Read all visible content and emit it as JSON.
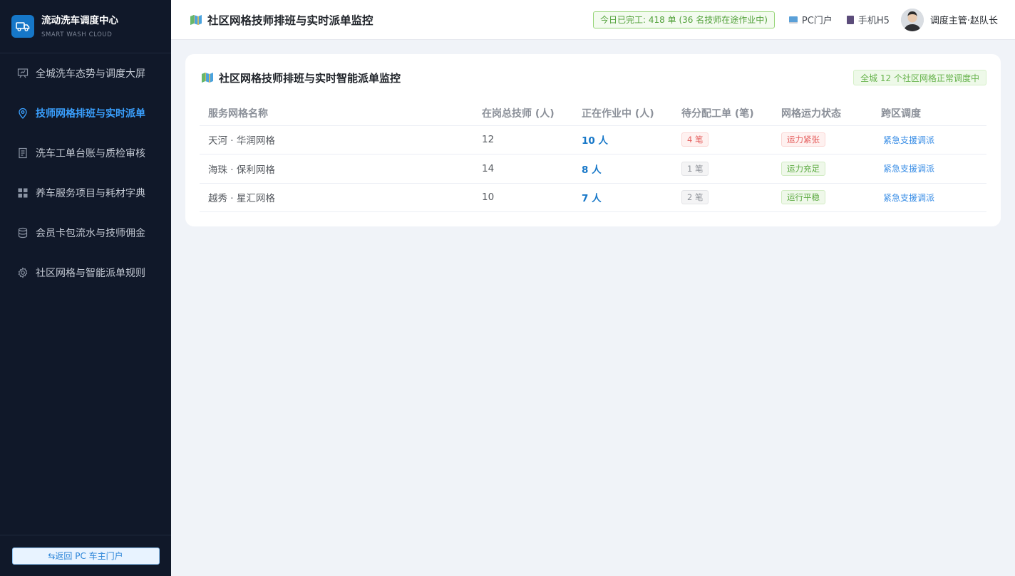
{
  "brand": {
    "title": "流动洗车调度中心",
    "subtitle": "SMART WASH CLOUD"
  },
  "sidebar": {
    "items": [
      {
        "label": "全城洗车态势与调度大屏",
        "icon": "presentation-board-icon",
        "active": false
      },
      {
        "label": "技师网格排班与实时派单",
        "icon": "location-pin-icon",
        "active": true
      },
      {
        "label": "洗车工单台账与质检审核",
        "icon": "document-icon",
        "active": false
      },
      {
        "label": "养车服务项目与耗材字典",
        "icon": "grid-apps-icon",
        "active": false
      },
      {
        "label": "会员卡包流水与技师佣金",
        "icon": "database-coins-icon",
        "active": false
      },
      {
        "label": "社区网格与智能派单规则",
        "icon": "gear-icon",
        "active": false
      }
    ],
    "back_button": "⇆返回 PC 车主门户"
  },
  "header": {
    "title": "社区网格技师排班与实时派单监控",
    "done_tag": "今日已完工: 418 单 (36 名技师在途作业中)",
    "pc_link": "PC门户",
    "h5_link": "手机H5",
    "user_name": "调度主管·赵队长"
  },
  "card": {
    "title": "社区网格技师排班与实时智能派单监控",
    "status_tag": "全城 12 个社区网格正常调度中",
    "columns": [
      "服务网格名称",
      "在岗总技师 (人)",
      "正在作业中 (人)",
      "待分配工单 (笔)",
      "网格运力状态",
      "跨区调度"
    ],
    "rows": [
      {
        "name": "天河 · 华润网格",
        "total": "12",
        "working": "10 人",
        "pending": "4 笔",
        "pending_style": "red",
        "status": "运力紧张",
        "status_style": "red",
        "action": "紧急支援调派"
      },
      {
        "name": "海珠 · 保利网格",
        "total": "14",
        "working": "8 人",
        "pending": "1 笔",
        "pending_style": "gray",
        "status": "运力充足",
        "status_style": "green",
        "action": "紧急支援调派"
      },
      {
        "name": "越秀 · 星汇网格",
        "total": "10",
        "working": "7 人",
        "pending": "2 笔",
        "pending_style": "gray",
        "status": "运行平稳",
        "status_style": "green",
        "action": "紧急支援调派"
      }
    ]
  },
  "colors": {
    "sidebar_bg": "#101829",
    "accent": "#1677c8",
    "active_nav": "#3aa0ff",
    "success": "#52a13a",
    "danger": "#e5605f"
  }
}
